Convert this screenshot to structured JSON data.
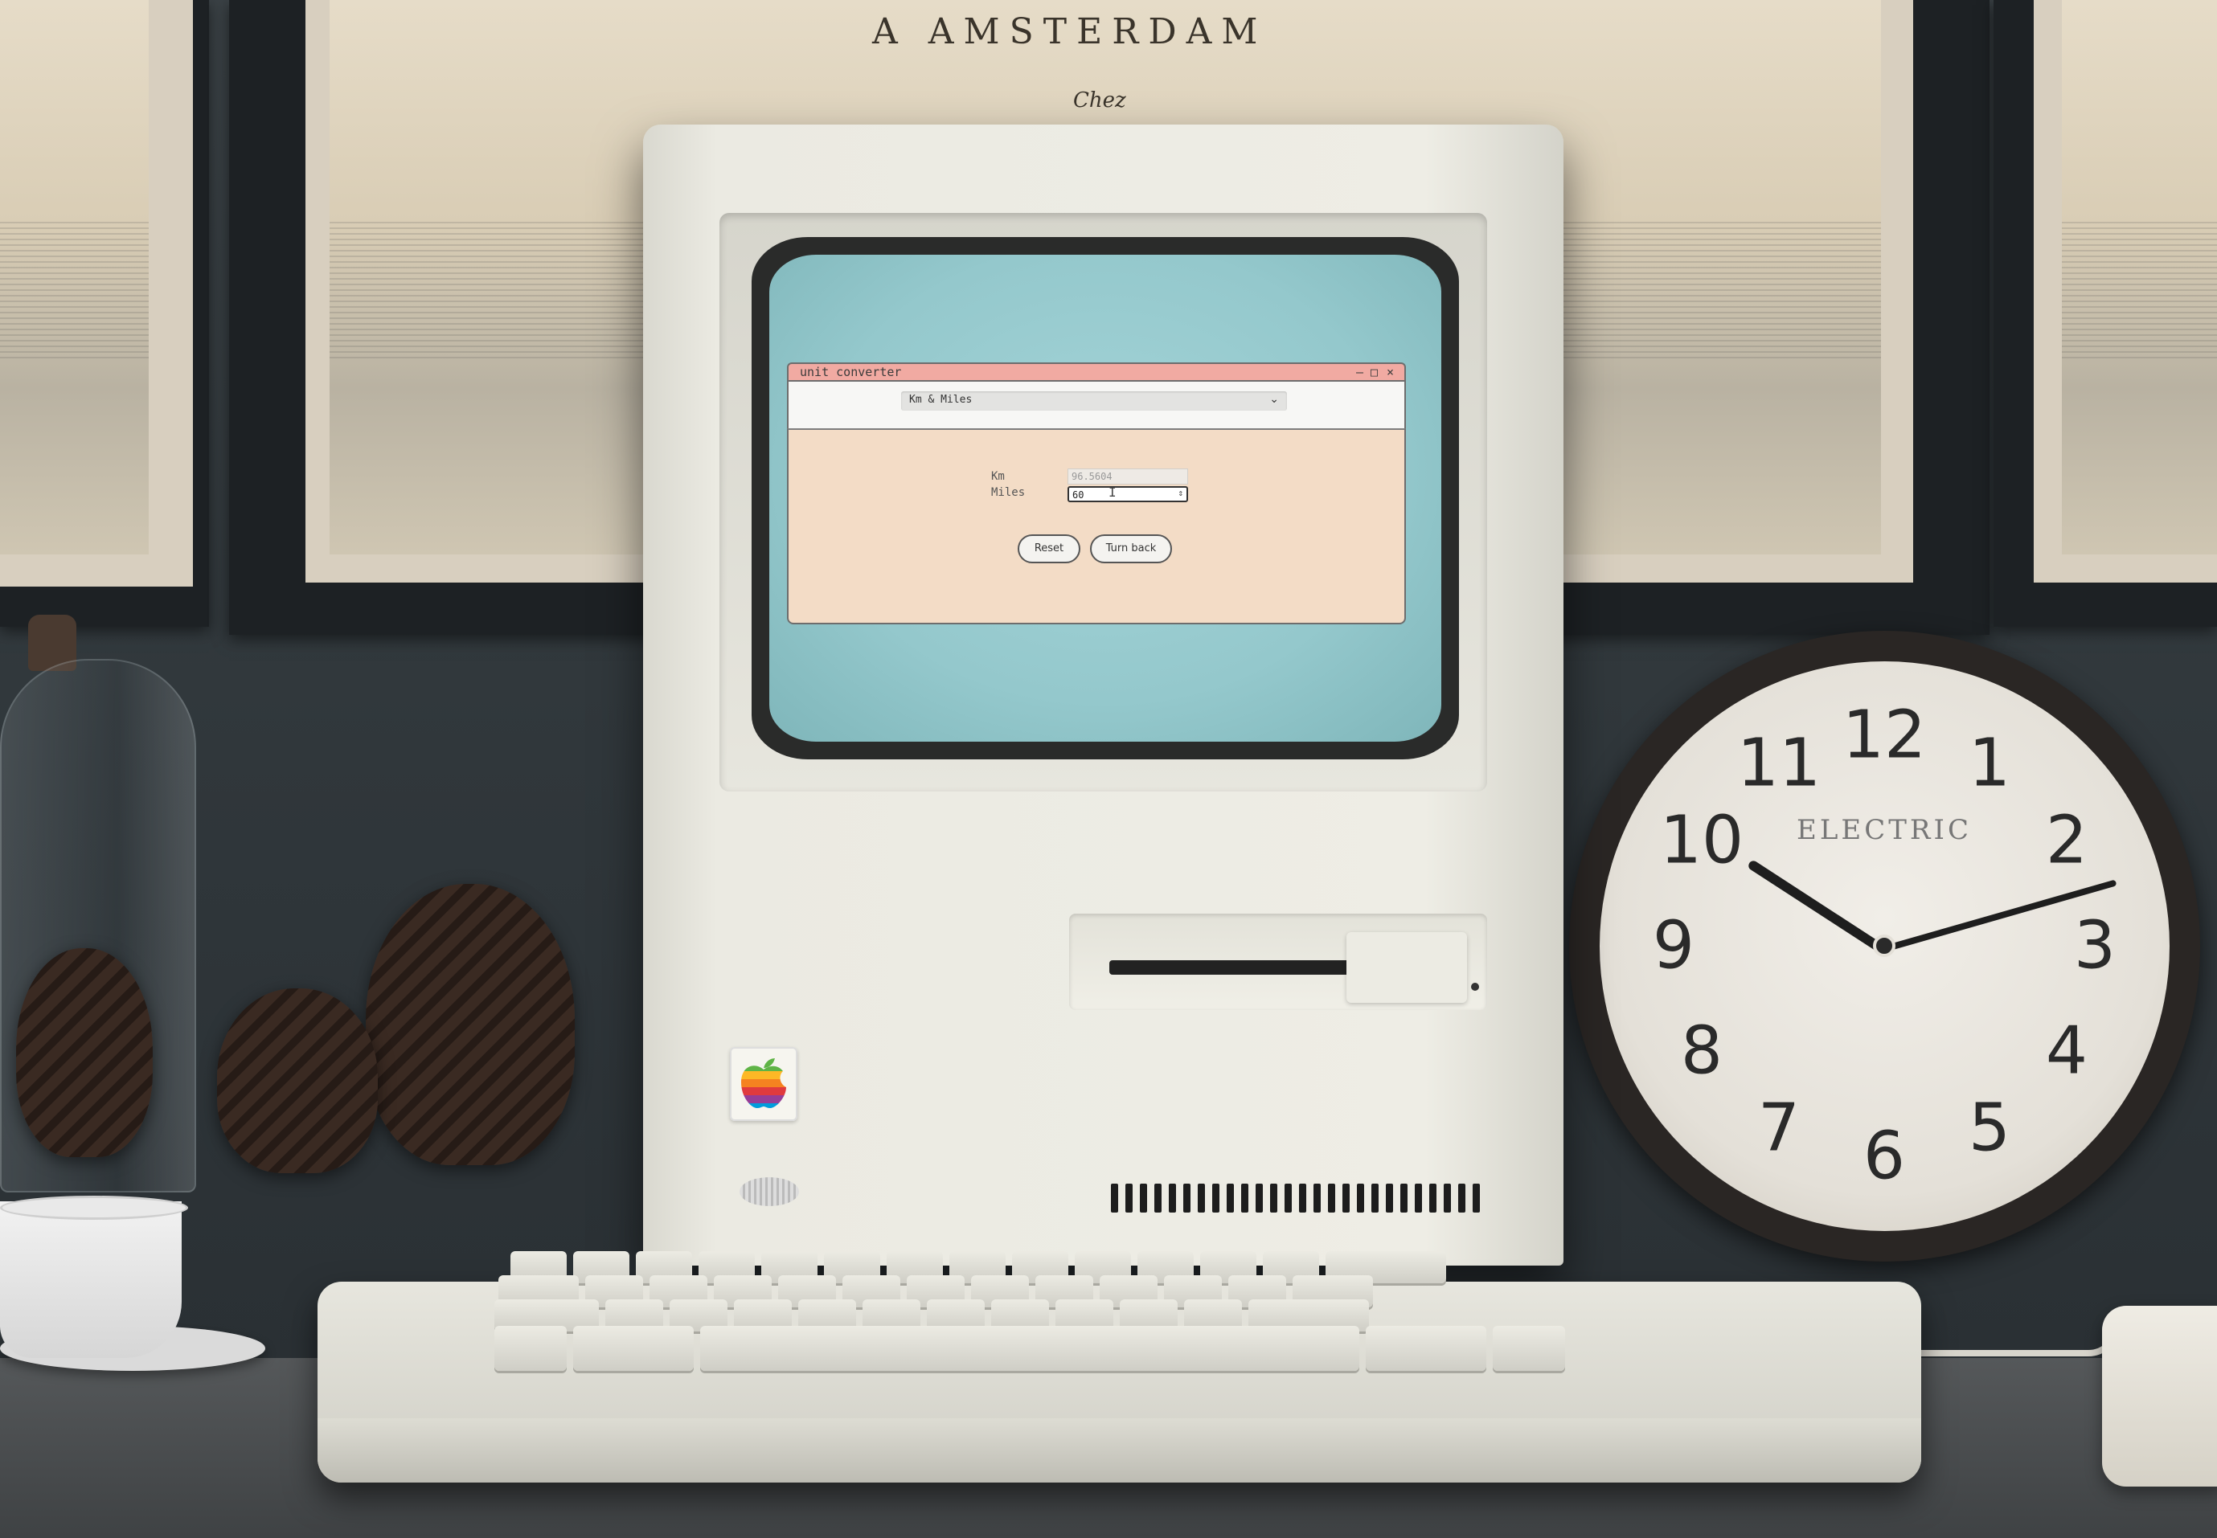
{
  "scene": {
    "map_title": "A AMSTERDAM",
    "map_subtitle": "Chez",
    "clock_brand": "ELECTRIC",
    "clock_numbers": [
      "12",
      "1",
      "2",
      "3",
      "4",
      "5",
      "6",
      "7",
      "8",
      "9",
      "10",
      "11"
    ]
  },
  "app": {
    "window_title": "unit converter",
    "window_controls": {
      "minimize": "–",
      "maximize": "□",
      "close": "×"
    },
    "conversion_select": {
      "value": "Km & Miles",
      "arrow_icon": "chevron-down-icon"
    },
    "fields": {
      "km": {
        "label": "Km",
        "value": "96.5604"
      },
      "miles": {
        "label": "Miles",
        "value": "60"
      }
    },
    "buttons": {
      "reset": "Reset",
      "turn_back": "Turn back"
    }
  },
  "colors": {
    "title_bar": "#f1aaa2",
    "window_body": "#f3dcc6",
    "screen": "#a4d4d8",
    "toolbar": "#f7f7f5"
  }
}
